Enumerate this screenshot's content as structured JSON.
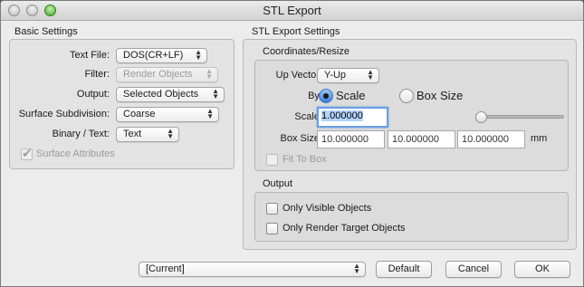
{
  "window": {
    "title": "STL Export"
  },
  "basic": {
    "section_title": "Basic Settings",
    "text_file_label": "Text File:",
    "text_file_value": "DOS(CR+LF)",
    "filter_label": "Filter:",
    "filter_value": "Render Objects",
    "output_label": "Output:",
    "output_value": "Selected Objects",
    "subdivision_label": "Surface Subdivision:",
    "subdivision_value": "Coarse",
    "binary_label": "Binary / Text:",
    "binary_value": "Text",
    "surface_attributes_label": "Surface Attributes",
    "surface_attributes_checked": true
  },
  "stl": {
    "section_title": "STL Export Settings",
    "coords_title": "Coordinates/Resize",
    "up_vector_label": "Up Vector:",
    "up_vector_value": "Y-Up",
    "by_label": "By:",
    "scale_option": "Scale",
    "box_size_option": "Box Size",
    "selected_option": "Scale",
    "scale_label": "Scale:",
    "scale_value": "1.000000",
    "box_size_label": "Box Size:",
    "box_x": "10.000000",
    "box_y": "10.000000",
    "box_z": "10.000000",
    "unit": "mm",
    "fit_to_box_label": "Fit To Box",
    "output_title": "Output",
    "only_visible_label": "Only Visible Objects",
    "only_render_target_label": "Only Render Target Objects"
  },
  "footer": {
    "preset_value": "[Current]",
    "default_label": "Default",
    "cancel_label": "Cancel",
    "ok_label": "OK"
  }
}
